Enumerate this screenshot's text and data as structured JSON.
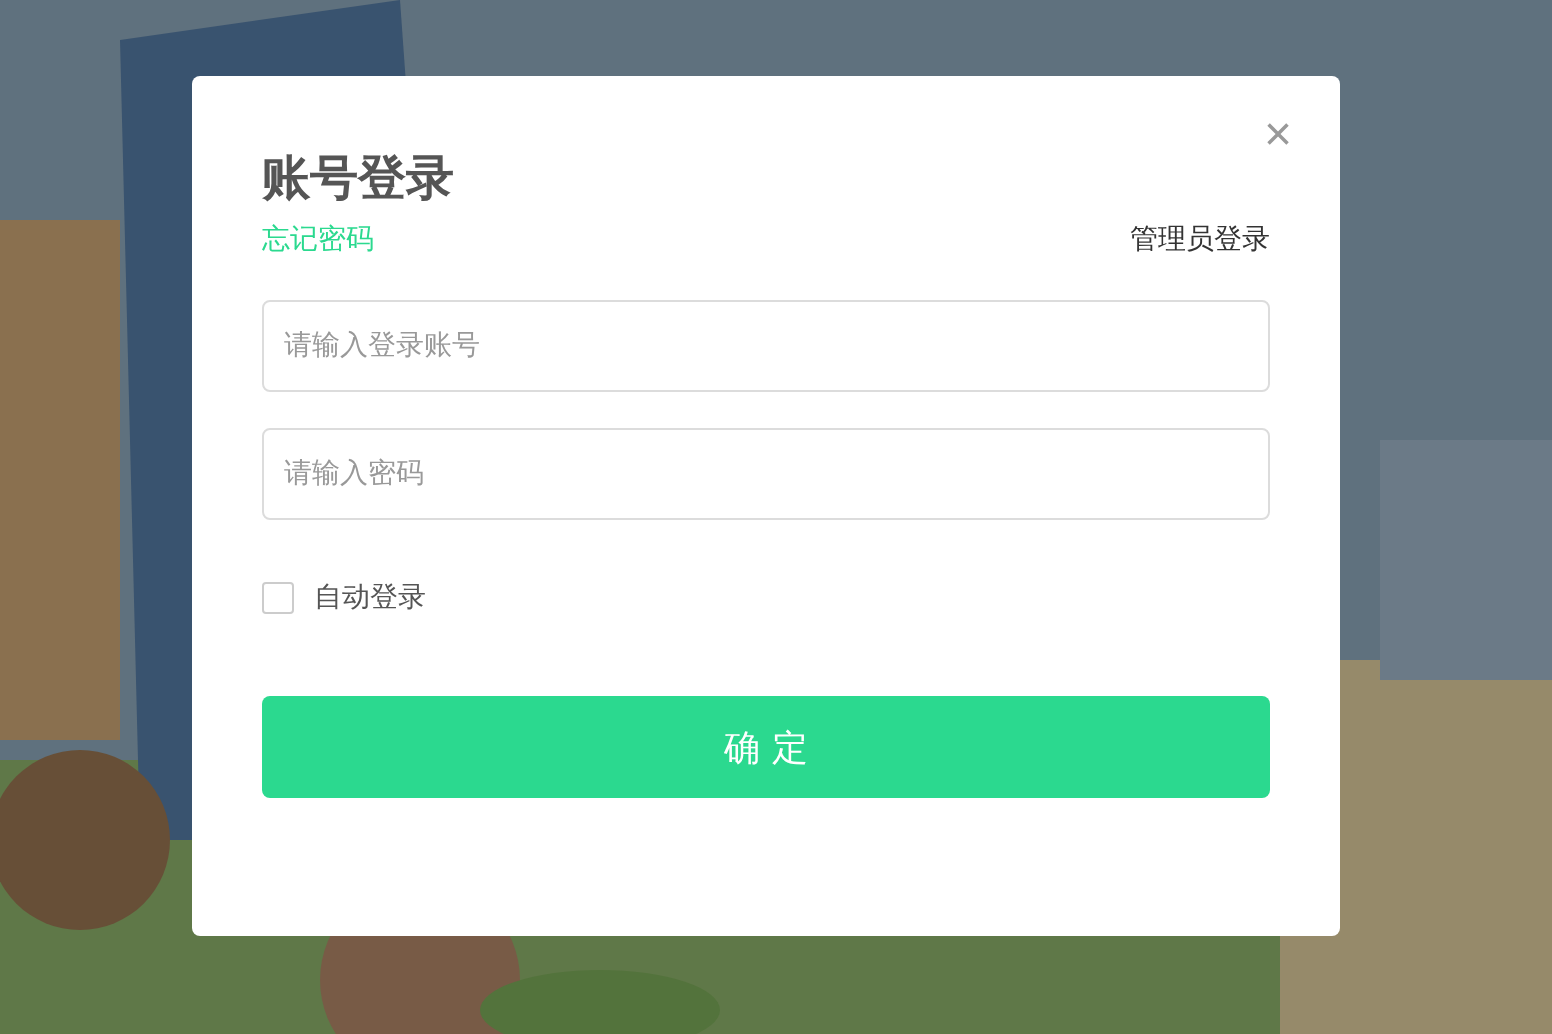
{
  "dialog": {
    "title": "账号登录",
    "close": "×",
    "forgot_link": "忘记密码",
    "admin_link": "管理员登录",
    "fields": [
      {
        "placeholder": "请输入登录账号"
      },
      {
        "placeholder": "请输入密码"
      }
    ],
    "auto_login": {
      "label": "自动登录",
      "checked": false
    },
    "submit": "确 定"
  }
}
